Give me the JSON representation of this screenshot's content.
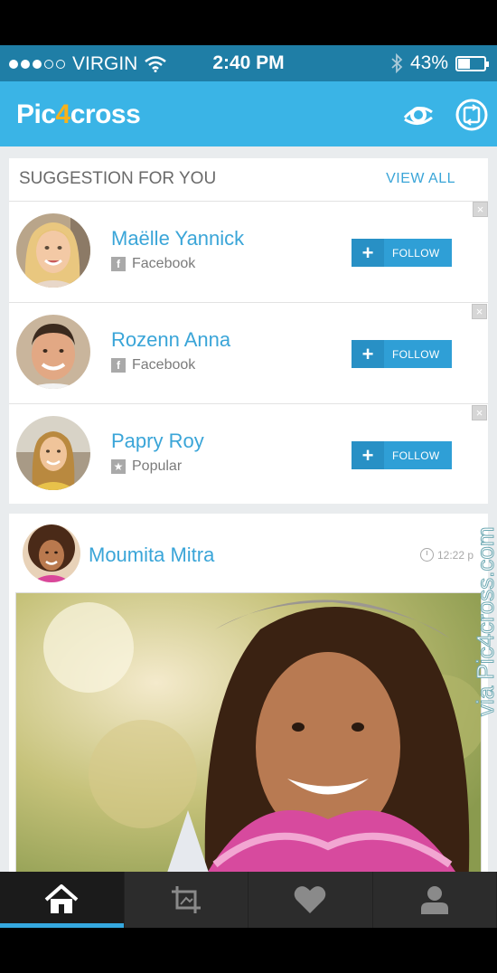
{
  "status_bar": {
    "carrier": "VIRGIN",
    "time": "2:40 PM",
    "battery": "43%",
    "battery_level": 0.43
  },
  "app_bar": {
    "logo_part1": "Pic",
    "logo_part2": "4",
    "logo_part3": "cross",
    "icons": [
      "camera-lens-icon",
      "refresh-frame-icon"
    ]
  },
  "suggestions": {
    "title": "SUGGESTION FOR YOU",
    "view_all": "VIEW ALL",
    "items": [
      {
        "name": "Maëlle Yannick",
        "source": "Facebook",
        "source_icon": "facebook-icon",
        "button": "FOLLOW",
        "plus": "+"
      },
      {
        "name": "Rozenn Anna",
        "source": "Facebook",
        "source_icon": "facebook-icon",
        "button": "FOLLOW",
        "plus": "+"
      },
      {
        "name": "Papry Roy",
        "source": "Popular",
        "source_icon": "star-icon",
        "button": "FOLLOW",
        "plus": "+"
      }
    ]
  },
  "post": {
    "author": "Moumita Mitra",
    "time": "12:22 p"
  },
  "watermark": "via Pic4cross.com",
  "tabs": [
    {
      "icon": "home-icon",
      "active": true
    },
    {
      "icon": "crop-icon",
      "active": false
    },
    {
      "icon": "heart-icon",
      "active": false
    },
    {
      "icon": "profile-icon",
      "active": false
    }
  ],
  "colors": {
    "status_bar": "#1f7ea6",
    "app_bar": "#3ab4e6",
    "accent": "#3aa5d8",
    "logo_accent": "#f7b21c",
    "follow_button": "#2f9fd6",
    "tab_bar": "#2c2c2c"
  }
}
